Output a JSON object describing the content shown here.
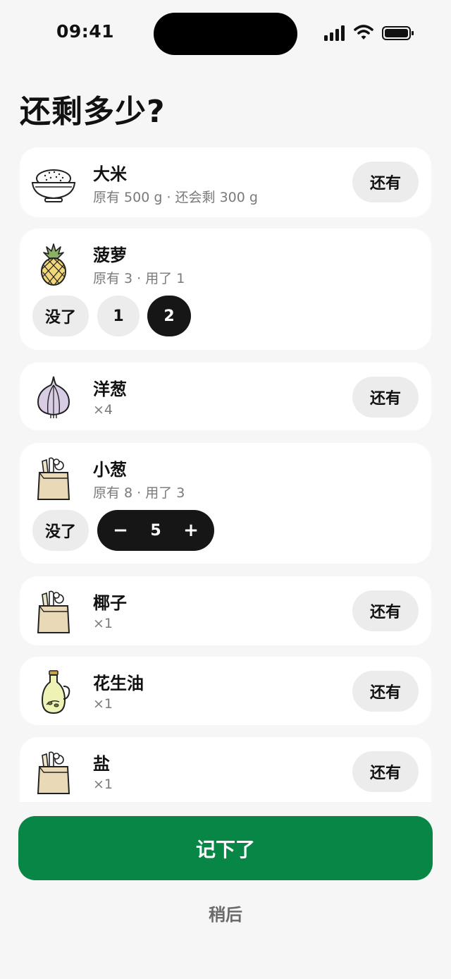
{
  "status_bar": {
    "time": "09:41"
  },
  "title": "还剩多少?",
  "items": [
    {
      "name": "大米",
      "sub": "原有 500 g · 还会剩 300 g",
      "icon": "rice-bowl-icon",
      "action": "还有"
    },
    {
      "name": "菠萝",
      "sub": "原有 3 · 用了 1",
      "icon": "pineapple-icon",
      "options": [
        "没了",
        "1",
        "2"
      ],
      "selected": "2"
    },
    {
      "name": "洋葱",
      "sub": "×4",
      "icon": "onion-icon",
      "action": "还有"
    },
    {
      "name": "小葱",
      "sub": "原有 8 · 用了 3",
      "icon": "grocery-bag-icon",
      "none_label": "没了",
      "stepper": {
        "minus": "−",
        "value": "5",
        "plus": "+"
      }
    },
    {
      "name": "椰子",
      "sub": "×1",
      "icon": "grocery-bag-icon",
      "action": "还有"
    },
    {
      "name": "花生油",
      "sub": "×1",
      "icon": "oil-bottle-icon",
      "action": "还有"
    },
    {
      "name": "盐",
      "sub": "×1",
      "icon": "grocery-bag-icon",
      "action": "还有"
    }
  ],
  "footer": {
    "save_label": "记下了",
    "later_label": "稍后"
  },
  "colors": {
    "primary": "#088646",
    "selected": "#161616",
    "chip": "#ececec",
    "background": "#f6f6f6"
  }
}
